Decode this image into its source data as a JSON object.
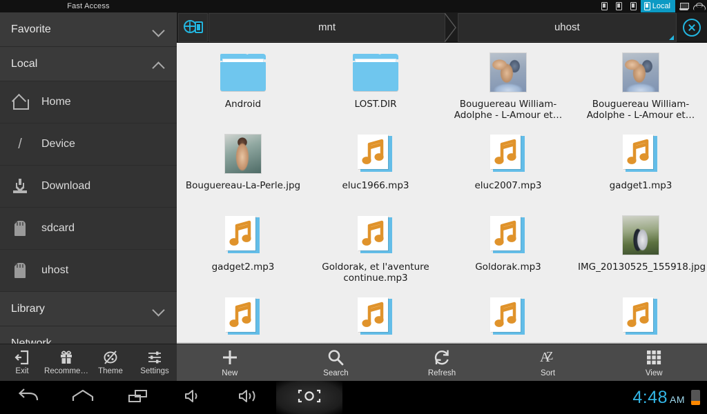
{
  "sidebar": {
    "title": "Fast Access",
    "sections": [
      {
        "label": "Favorite",
        "chevron": "chevron-down-icon",
        "expanded": false
      },
      {
        "label": "Local",
        "chevron": "chevron-up-icon",
        "expanded": true
      }
    ],
    "items": [
      {
        "label": "Home",
        "icon": "home-icon"
      },
      {
        "label": "Device",
        "icon": "slash-icon"
      },
      {
        "label": "Download",
        "icon": "download-icon"
      },
      {
        "label": "sdcard",
        "icon": "sdcard-icon"
      },
      {
        "label": "uhost",
        "icon": "sdcard-icon"
      }
    ],
    "sections_after": [
      {
        "label": "Library",
        "chevron": "chevron-down-icon"
      },
      {
        "label": "Network",
        "chevron": "chevron-down-icon"
      }
    ],
    "tools": [
      {
        "label": "Exit",
        "icon": "exit-icon"
      },
      {
        "label": "Recomme…",
        "icon": "gift-icon"
      },
      {
        "label": "Theme",
        "icon": "palette-icon"
      },
      {
        "label": "Settings",
        "icon": "sliders-icon"
      }
    ]
  },
  "topbar": {
    "tabs": [
      {
        "label": "",
        "icon": "tablet-icon",
        "active": false
      },
      {
        "label": "",
        "icon": "tablet-icon",
        "active": false
      },
      {
        "label": "",
        "icon": "tablet-icon",
        "active": false
      },
      {
        "label": "Local",
        "icon": "tablet-icon",
        "active": true
      }
    ],
    "system_icons": [
      "pc-icon",
      "cloud-icon"
    ],
    "active_color": "#0c9ac4"
  },
  "pathbar": {
    "network_button": "network-device-icon",
    "crumbs": [
      "mnt",
      "uhost"
    ],
    "close_label": "close-icon",
    "accent_color": "#23b6e0"
  },
  "files": [
    {
      "name": "Android",
      "type": "folder"
    },
    {
      "name": "LOST.DIR",
      "type": "folder"
    },
    {
      "name": "Bouguereau William-Adolphe - L-Amour et…",
      "type": "image",
      "thumb": "amour"
    },
    {
      "name": "Bouguereau William-Adolphe - L-Amour et…",
      "type": "image",
      "thumb": "amour"
    },
    {
      "name": "Bouguereau-La-Perle.jpg",
      "type": "image",
      "thumb": "perle"
    },
    {
      "name": "eluc1966.mp3",
      "type": "audio"
    },
    {
      "name": "eluc2007.mp3",
      "type": "audio"
    },
    {
      "name": "gadget1.mp3",
      "type": "audio"
    },
    {
      "name": "gadget2.mp3",
      "type": "audio"
    },
    {
      "name": "Goldorak, et l'aventure continue.mp3",
      "type": "audio"
    },
    {
      "name": "Goldorak.mp3",
      "type": "audio"
    },
    {
      "name": "IMG_20130525_155918.jpg",
      "type": "image",
      "thumb": "wedding"
    },
    {
      "name": "",
      "type": "audio"
    },
    {
      "name": "",
      "type": "audio"
    },
    {
      "name": "",
      "type": "audio"
    },
    {
      "name": "",
      "type": "audio"
    }
  ],
  "apptools": [
    {
      "label": "New",
      "icon": "plus-icon"
    },
    {
      "label": "Search",
      "icon": "search-icon"
    },
    {
      "label": "Refresh",
      "icon": "refresh-icon"
    },
    {
      "label": "Sort",
      "icon": "sort-az-icon"
    },
    {
      "label": "View",
      "icon": "grid-view-icon"
    }
  ],
  "navbar": {
    "buttons": [
      "back-icon",
      "home-icon",
      "recents-icon",
      "volume-down-icon",
      "volume-up-icon",
      "screenshot-icon"
    ],
    "clock": "4:48",
    "ampm": "AM",
    "clock_color": "#33b5e5",
    "battery": "battery-icon"
  }
}
